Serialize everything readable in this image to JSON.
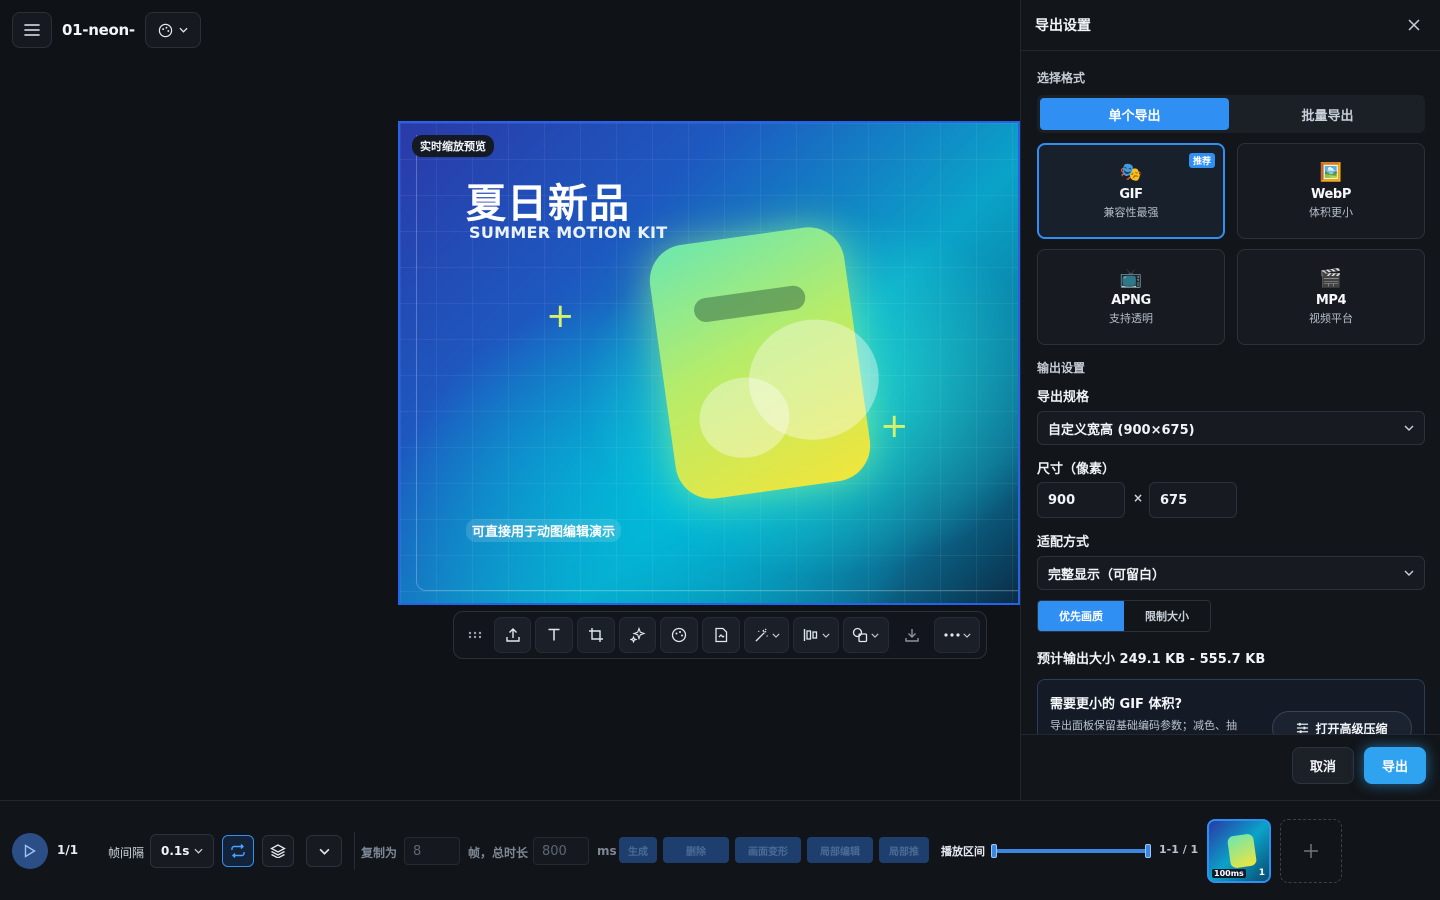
{
  "app": {
    "doc_title": "01-neon-",
    "menu_icon": "menu-icon",
    "theme_icon": "palette-icon"
  },
  "preview": {
    "badge": "实时缩放预览",
    "title": "夏日新品",
    "subtitle": "SUMMER MOTION KIT",
    "caption": "可直接用于动图编辑演示",
    "plus_1": "+",
    "plus_2": "+"
  },
  "toolbar": {
    "tools": [
      "drag-handle-icon",
      "upload-icon",
      "text-icon",
      "crop-icon",
      "sparkle-icon",
      "palette-icon",
      "sticker-icon",
      "magic-wand-icon",
      "align-icon",
      "shapes-icon",
      "download-icon",
      "more-icon"
    ]
  },
  "panel": {
    "title": "导出设置",
    "format_section": "选择格式",
    "mode_tabs": [
      "单个导出",
      "批量导出"
    ],
    "formats": [
      {
        "icon": "🎭",
        "name": "GIF",
        "desc": "兼容性最强",
        "badge": "推荐"
      },
      {
        "icon": "🖼️",
        "name": "WebP",
        "desc": "体积更小"
      },
      {
        "icon": "📺",
        "name": "APNG",
        "desc": "支持透明"
      },
      {
        "icon": "🎬",
        "name": "MP4",
        "desc": "视频平台"
      }
    ],
    "output_section": "输出设置",
    "spec_label": "导出规格",
    "spec_value": "自定义宽高 (900×675)",
    "size_label": "尺寸（像素）",
    "width": "900",
    "times": "×",
    "height": "675",
    "fit_label": "适配方式",
    "fit_value": "完整显示（可留白）",
    "priority_tabs": [
      "优先画质",
      "限制大小"
    ],
    "estimate": "预计输出大小 249.1 KB - 555.7 KB",
    "tip_title": "需要更小的 GIF 体积?",
    "tip_text": "导出面板保留基础编码参数；减色、抽",
    "tip_button": "打开高级压缩",
    "cancel": "取消",
    "export": "导出"
  },
  "timeline": {
    "frame_count": "1/1",
    "interval_label": "帧间隔",
    "interval_value": "0.1s",
    "copy_label": "复制为",
    "copy_value": "8",
    "frames_total_label": "帧，总时长",
    "duration_value": "800",
    "ms": "ms",
    "actions": [
      "生成",
      "删除",
      "画面变形",
      "局部编辑",
      "局部推"
    ],
    "range_label": "播放区间",
    "range_value": "1-1 / 1",
    "thumb_ms": "100ms",
    "thumb_index": "1",
    "range_start": 0.0,
    "range_end": 1.0
  },
  "colors": {
    "accent": "#2f8ff2",
    "selection_border": "#2563eb"
  }
}
